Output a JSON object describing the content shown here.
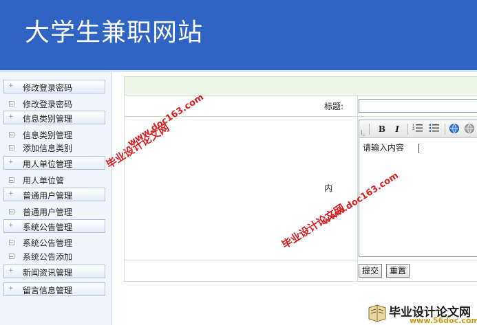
{
  "header": {
    "title": "大学生兼职网站"
  },
  "sidebar": {
    "sections": [
      {
        "label": "修改登录密码",
        "items": [
          "修改登录密码"
        ]
      },
      {
        "label": "信息类别管理",
        "items": [
          "信息类别管理",
          "添加信息类别"
        ]
      },
      {
        "label": "用人单位管理",
        "items": [
          "用人单位管"
        ]
      },
      {
        "label": "普通用户管理",
        "items": [
          "普通用户管理"
        ]
      },
      {
        "label": "系统公告管理",
        "items": [
          "系统公告管理",
          "系统公告添加"
        ]
      },
      {
        "label": "新闻资讯管理",
        "items": []
      },
      {
        "label": "留言信息管理",
        "items": []
      }
    ]
  },
  "form": {
    "title_label": "标题:",
    "content_label": "内",
    "editor_text": "请输入内容",
    "submit_label": "提交",
    "reset_label": "重置"
  },
  "editor_toolbar": {
    "bold": "B",
    "italic": "I"
  },
  "watermark": {
    "url": "www.doc163.com",
    "cn": "毕业设计论文网",
    "badge_name": "毕业设计论文网",
    "badge_url": "www.56doc.com"
  },
  "colors": {
    "header_bg": "#2f64c4",
    "watermark": "#d81f1f",
    "badge_url": "#c89a19"
  }
}
